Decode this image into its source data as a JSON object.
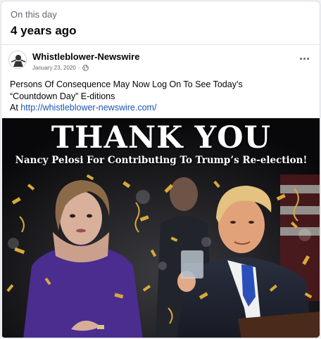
{
  "memory": {
    "label": "On this day",
    "years_ago": "4 years ago"
  },
  "post": {
    "author": "Whistleblower-Newswire",
    "date": "January 23, 2020",
    "date_separator": "·",
    "privacy_icon": "globe-icon",
    "more_icon": "more-options-icon",
    "text_line1": "Persons Of Consequence May Now Log On To See Today’s",
    "text_line2": "“Countdown Day” E-ditions",
    "text_prefix": "At ",
    "link": "http://whistleblower-newswire.com/"
  },
  "image": {
    "headline": "THANK YOU",
    "subline": "Nancy Pelosi For Contributing To Trump’s Re-election!"
  },
  "colors": {
    "link": "#1a55b8",
    "confetti_gold": "#d9a93a",
    "background": "#0d0d0f"
  }
}
